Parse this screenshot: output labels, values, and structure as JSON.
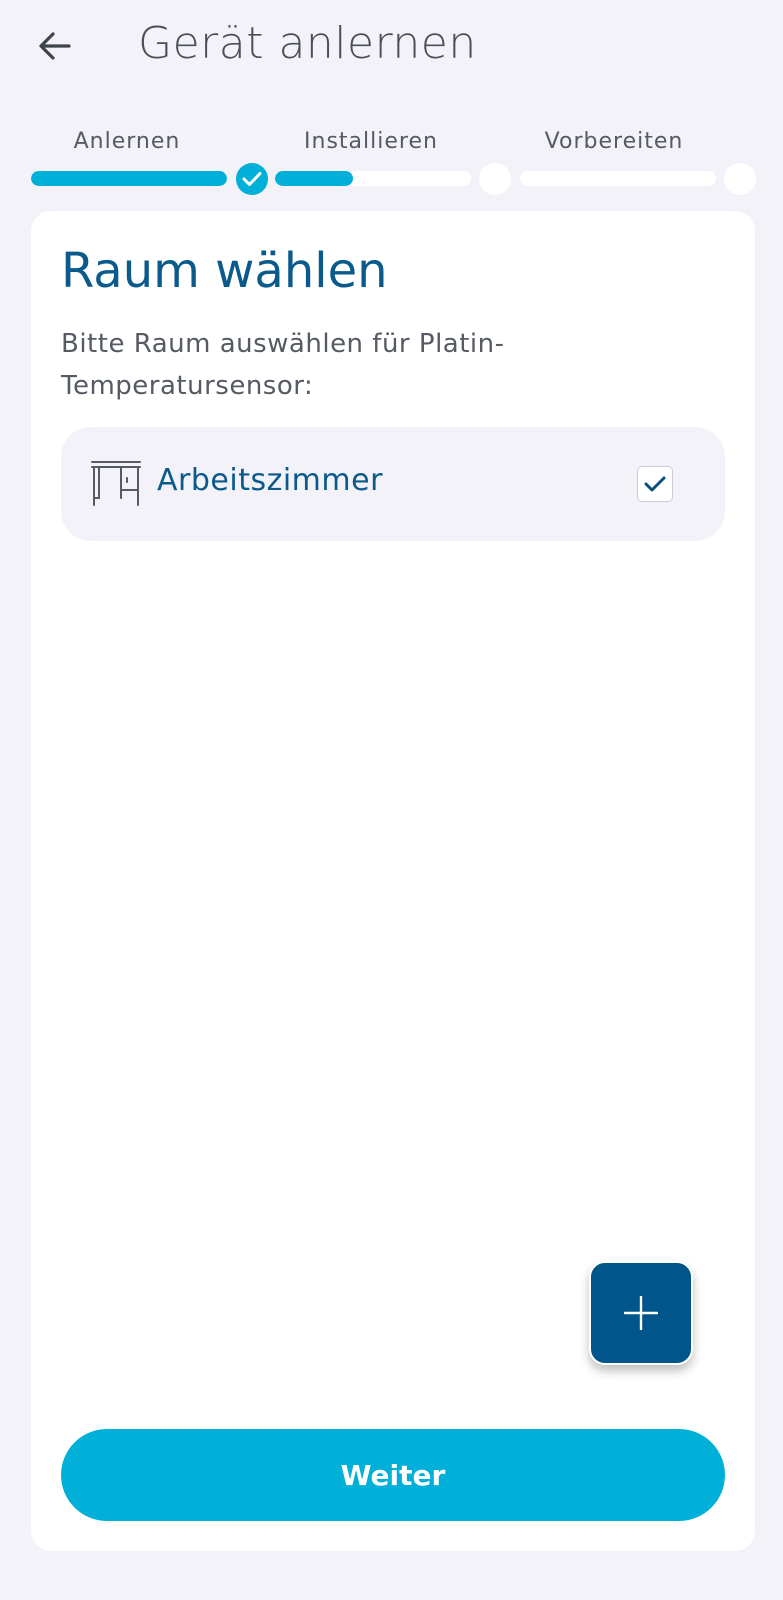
{
  "header": {
    "title": "Gerät anlernen",
    "back_icon": "arrow-left-icon"
  },
  "stepper": {
    "steps": [
      {
        "label": "Anlernen",
        "progress": 1.0,
        "done": true
      },
      {
        "label": "Installieren",
        "progress": 0.4,
        "done": false
      },
      {
        "label": "Vorbereiten",
        "progress": 0.0,
        "done": false
      }
    ],
    "accent_color": "#00b0d8"
  },
  "card": {
    "title": "Raum wählen",
    "description": "Bitte Raum auswählen für Platin-Temperatursensor:",
    "rooms": [
      {
        "label": "Arbeitszimmer",
        "icon": "desk-icon",
        "checked": true
      }
    ]
  },
  "fab": {
    "icon": "plus-icon"
  },
  "actions": {
    "next_label": "Weiter"
  },
  "colors": {
    "primary_dark": "#0b5a8c",
    "accent": "#00b0d8",
    "fab": "#00568a",
    "background": "#f2f2f8"
  }
}
